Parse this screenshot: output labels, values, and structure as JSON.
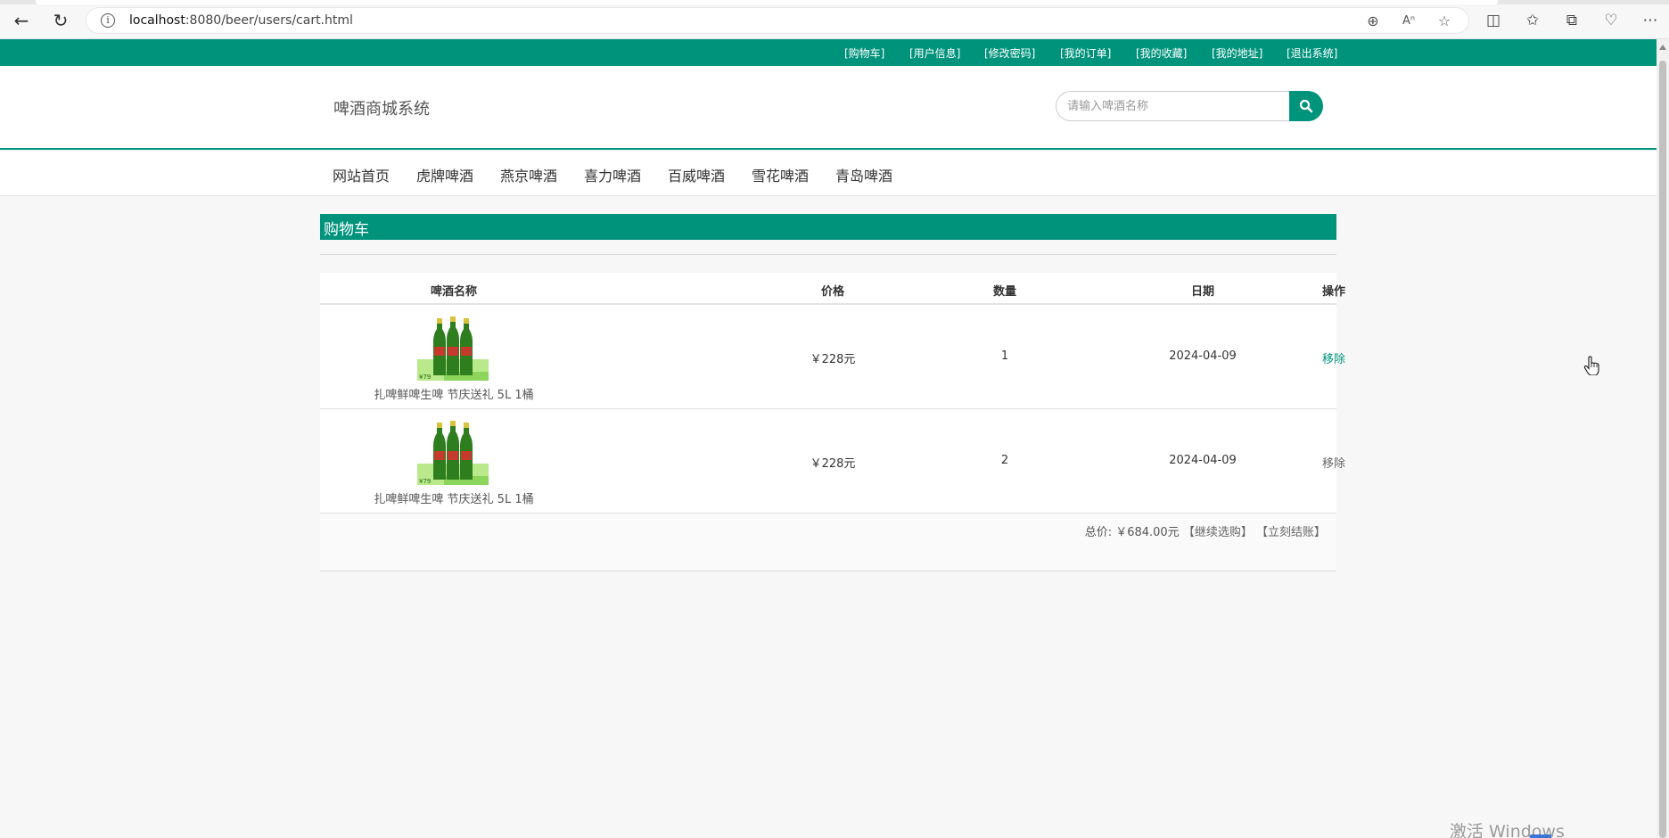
{
  "browser": {
    "url_host": "localhost",
    "url_path": ":8080/beer/users/cart.html"
  },
  "topbar": {
    "links": [
      "[购物车]",
      "[用户信息]",
      "[修改密码]",
      "[我的订单]",
      "[我的收藏]",
      "[我的地址]",
      "[退出系统]"
    ]
  },
  "header": {
    "logo": "啤酒商城系统",
    "search_placeholder": "请输入啤酒名称"
  },
  "menu": {
    "items": [
      "网站首页",
      "虎牌啤酒",
      "燕京啤酒",
      "喜力啤酒",
      "百威啤酒",
      "雪花啤酒",
      "青岛啤酒"
    ]
  },
  "cart": {
    "title": "购物车",
    "columns": [
      "啤酒名称",
      "价格",
      "数量",
      "日期",
      "操作"
    ],
    "rows": [
      {
        "name": "扎啤鲜啤生啤 节庆送礼 5L 1桶",
        "price": "￥228元",
        "qty": "1",
        "date": "2024-04-09",
        "action": "移除"
      },
      {
        "name": "扎啤鲜啤生啤 节庆送礼 5L 1桶",
        "price": "￥228元",
        "qty": "2",
        "date": "2024-04-09",
        "action": "移除"
      }
    ],
    "total_label": "总价: ￥684.00元",
    "continue_label": "【继续选购】",
    "checkout_label": "【立刻结账】"
  },
  "watermark": "激活 Windows",
  "colors": {
    "primary": "#00937c"
  }
}
